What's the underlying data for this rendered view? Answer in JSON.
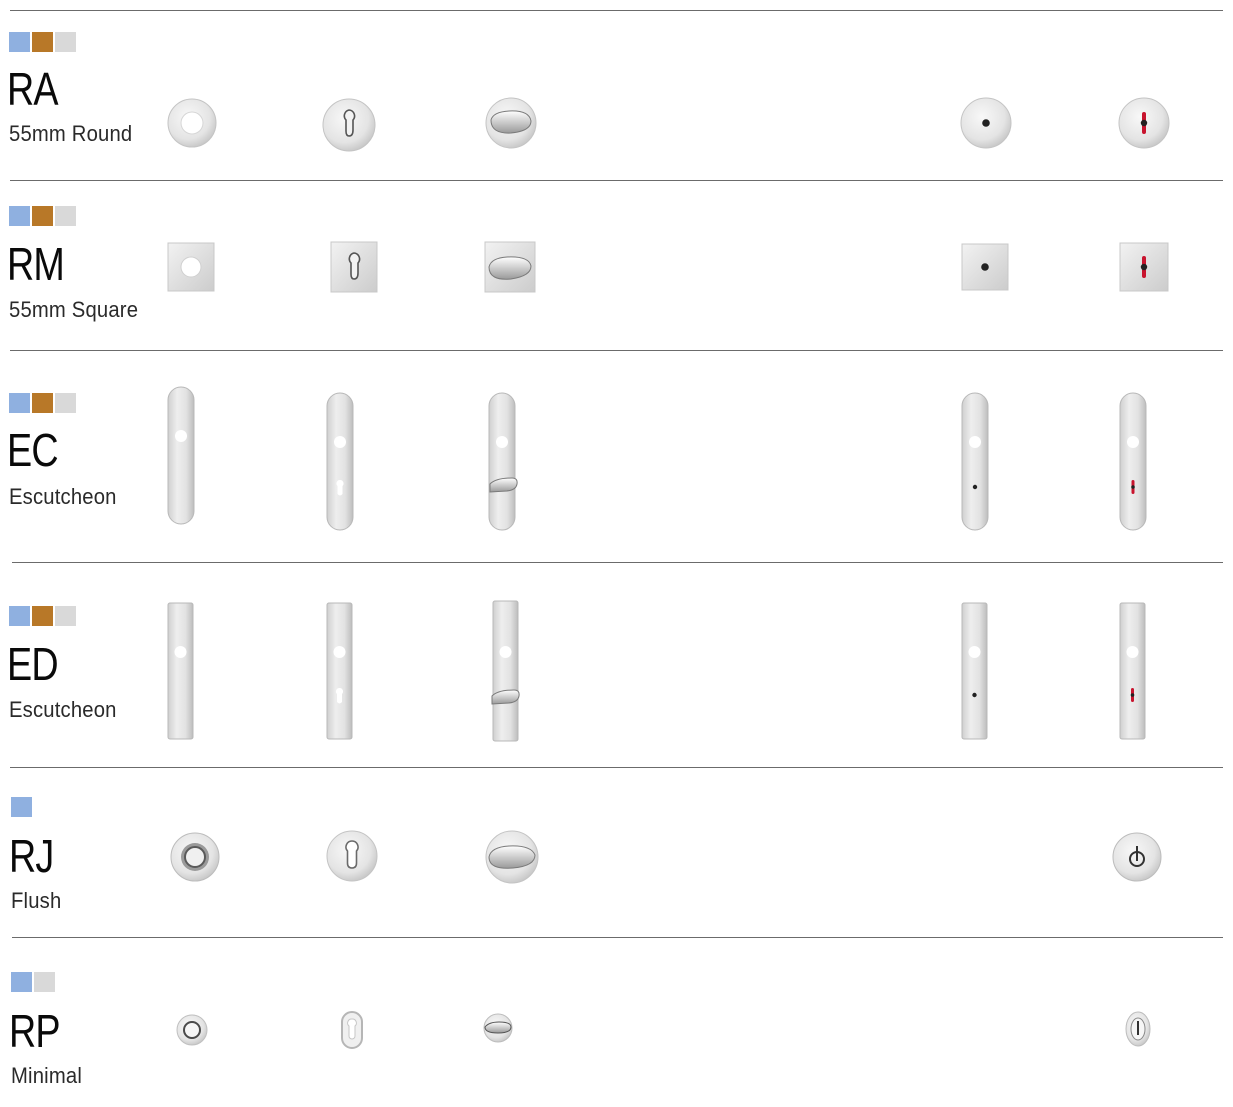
{
  "finish_colors": {
    "blue": "#8fb0e0",
    "bronze": "#b87828",
    "grey": "#d9d9d9"
  },
  "accent_red": "#c8142e",
  "rows": [
    {
      "code": "RA",
      "subtitle": "55mm Round",
      "finishes": [
        "blue",
        "bronze",
        "grey"
      ],
      "products": [
        "plain-round-rose",
        "keyhole-round-rose",
        "thumbturn-round-rose",
        "release-round-rose",
        "indicator-round-rose"
      ]
    },
    {
      "code": "RM",
      "subtitle": "55mm Square",
      "finishes": [
        "blue",
        "bronze",
        "grey"
      ],
      "products": [
        "plain-square-rose",
        "keyhole-square-rose",
        "thumbturn-square-rose",
        "release-square-rose",
        "indicator-square-rose"
      ]
    },
    {
      "code": "EC",
      "subtitle": "Escutcheon",
      "finishes": [
        "blue",
        "bronze",
        "grey"
      ],
      "products": [
        "plain-rounded-plate",
        "keyhole-rounded-plate",
        "thumbturn-rounded-plate",
        "release-rounded-plate",
        "indicator-rounded-plate"
      ]
    },
    {
      "code": "ED",
      "subtitle": "Escutcheon",
      "finishes": [
        "blue",
        "bronze",
        "grey"
      ],
      "products": [
        "plain-square-plate",
        "keyhole-square-plate",
        "thumbturn-square-plate",
        "release-square-plate",
        "indicator-square-plate"
      ]
    },
    {
      "code": "RJ",
      "subtitle": "Flush",
      "finishes": [
        "blue"
      ],
      "products": [
        "ring-flush-rose",
        "euro-keyhole-flush-rose",
        "thumbturn-flush-rose",
        "indicator-flush-rose"
      ]
    },
    {
      "code": "RP",
      "subtitle": "Minimal",
      "finishes": [
        "blue",
        "grey"
      ],
      "products": [
        "ring-minimal-rose",
        "euro-keyhole-minimal",
        "thumbturn-minimal",
        "indicator-minimal"
      ]
    }
  ]
}
